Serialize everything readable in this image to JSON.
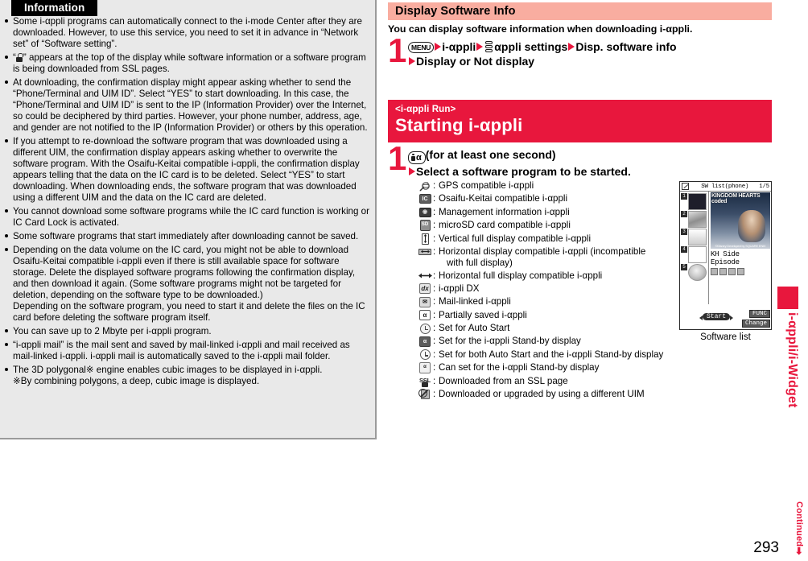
{
  "info_box": {
    "title": "Information",
    "items": [
      {
        "text": "Some i-αppli programs can automatically connect to the i-mode Center after they are downloaded. However, to use this service, you need to set it in advance in “Network set” of “Software setting”."
      },
      {
        "lock_prefix": "“",
        "lock_suffix": "” appears at the top of the display while software information or a software program is being downloaded from SSL pages.",
        "has_lock_icon": true
      },
      {
        "text": "At downloading, the confirmation display might appear asking whether to send the “Phone/Terminal and UIM ID”. Select “YES” to start downloading. In this case, the “Phone/Terminal and UIM ID” is sent to the IP (Information Provider) over the Internet, so could be deciphered by third parties. However, your phone number, address, age, and gender are not notified to the IP (Information Provider) or others by this operation."
      },
      {
        "text": "If you attempt to re-download the software program that was downloaded using a different UIM, the confirmation display appears asking whether to overwrite the software program. With the Osaifu-Keitai compatible i-αppli, the confirmation display appears telling that the data on the IC card is to be deleted. Select “YES” to start downloading. When downloading ends, the software program that was downloaded using a different UIM and the data on the IC card are deleted."
      },
      {
        "text": "You cannot download some software programs while the IC card function is working or IC Card Lock is activated."
      },
      {
        "text": "Some software programs that start immediately after downloading cannot be saved."
      },
      {
        "text": "Depending on the data volume on the IC card, you might not be able to download Osaifu-Keitai compatible i-αppli even if there is still available space for software storage. Delete the displayed software programs following the confirmation display, and then download it again. (Some software programs might not be targeted for deletion, depending on the software type to be downloaded.)",
        "second_para": "Depending on the software program, you need to start it and delete the files on the IC card before deleting the software program itself."
      },
      {
        "text": "You can save up to 2 Mbyte per i-αppli program."
      },
      {
        "text": "“i-αppli mail” is the mail sent and saved by mail-linked i-αppli and mail received as mail-linked i-αppli. i-αppli mail is automatically saved to the i-αppli mail folder."
      },
      {
        "text": "The 3D polygonal※ engine enables cubic images to be displayed in i-αppli.",
        "second_para": "※By combining polygons, a deep, cubic image is displayed."
      }
    ]
  },
  "section": {
    "header": "Display Software Info",
    "lead": "You can display software information when downloading i-αppli.",
    "step_number": "1",
    "step_line1_part1": "i-αppli",
    "step_line1_part2": "αppli settings",
    "step_line1_part3": "Disp. software info",
    "step_line2": "Display or Not display",
    "menu_key_label": "MENU"
  },
  "run_section": {
    "eyebrow": "<i-αppli Run>",
    "title": "Starting i-αppli",
    "step_number": "1",
    "step_line1": "(for at least one second)",
    "step_line2": "Select a software program to be started."
  },
  "legend": {
    "rows": [
      {
        "icon": "gps-icon",
        "colon": ":",
        "text": "GPS compatible i-αppli"
      },
      {
        "icon": "ic-card-icon",
        "colon": ":",
        "text": "Osaifu-Keitai compatible i-αppli"
      },
      {
        "icon": "management-info-icon",
        "colon": ":",
        "text": "Management information i-αppli"
      },
      {
        "icon": "microsd-icon",
        "colon": ":",
        "text": "microSD card compatible i-αppli"
      },
      {
        "icon": "vertical-full-display-icon",
        "colon": ":",
        "text": "Vertical full display compatible i-αppli"
      },
      {
        "icon": "horizontal-display-icon",
        "colon": ":",
        "text": "Horizontal display compatible i-αppli (incompatible",
        "continuation": "with full display)"
      },
      {
        "icon": "horizontal-full-display-icon",
        "colon": ":",
        "text": "Horizontal full display compatible i-αppli"
      },
      {
        "icon": "iappli-dx-icon",
        "colon": ":",
        "text": "i-αppli DX"
      },
      {
        "icon": "mail-linked-icon",
        "colon": ":",
        "text": "Mail-linked i-αppli"
      },
      {
        "icon": "partially-saved-icon",
        "colon": ":",
        "text": "Partially saved i-αppli"
      },
      {
        "icon": "auto-start-icon",
        "colon": ":",
        "text": "Set for Auto Start"
      },
      {
        "icon": "standby-display-icon",
        "colon": ":",
        "text": "Set for the i-αppli Stand-by display"
      },
      {
        "icon": "auto-start-and-standby-icon",
        "colon": ":",
        "text": "Set for both Auto Start and the i-αppli Stand-by display"
      },
      {
        "icon": "can-set-standby-icon",
        "colon": ":",
        "text": "Can set for the i-αppli Stand-by display"
      },
      {
        "icon": "ssl-icon",
        "colon": ":",
        "text": "Downloaded from an SSL page"
      },
      {
        "icon": "different-uim-icon",
        "colon": ":",
        "text": "Downloaded or upgraded by using a different UIM"
      }
    ]
  },
  "phone_screen": {
    "status_title": "SW list(phone)",
    "page_indicator": "1/5",
    "thumbs": [
      "1",
      "2",
      "3",
      "4",
      "5"
    ],
    "banner_title": "KINGDOM HEARTS coded",
    "banner_credit": "©Disney Developed by SQUARE ENIX",
    "app_name": "KH Side Episode",
    "softkey_center": "Start",
    "softkey_top_right": "FUNC",
    "softkey_bottom_right": "Change",
    "caption": "Software list"
  },
  "sidebar": {
    "tab_label": "i-αppli/i-Widget",
    "accent_color": "#e8173d"
  },
  "footer": {
    "continued": "Continued",
    "continued_arrow": "➡",
    "page_number": "293"
  }
}
